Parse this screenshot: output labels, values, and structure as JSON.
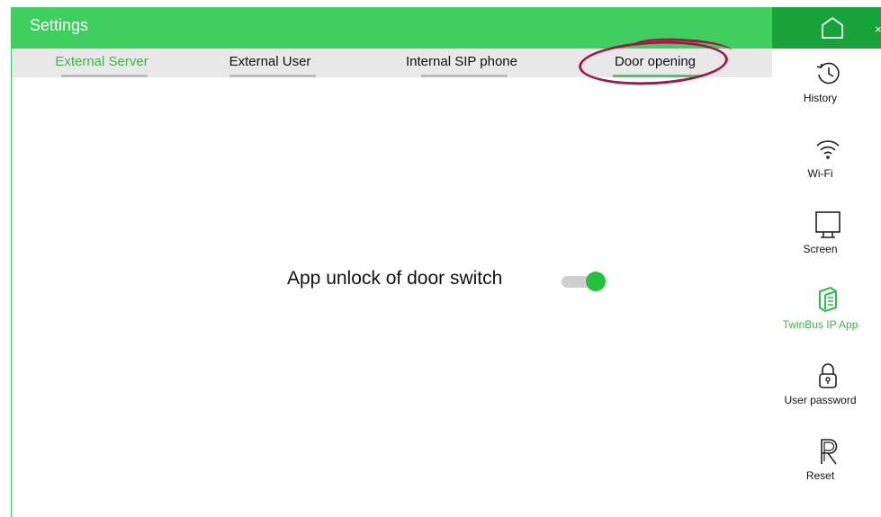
{
  "header": {
    "title": "Settings"
  },
  "tabs": [
    {
      "label": "External Server"
    },
    {
      "label": "External User"
    },
    {
      "label": "Internal SIP phone"
    },
    {
      "label": "Door opening"
    }
  ],
  "setting": {
    "label": "App unlock of door switch",
    "enabled": true
  },
  "sidebar": {
    "close": "×",
    "items": [
      {
        "label": "History",
        "icon": "history-icon"
      },
      {
        "label": "Wi-Fi",
        "icon": "wifi-icon"
      },
      {
        "label": "Screen",
        "icon": "screen-icon"
      },
      {
        "label": "TwinBus IP App",
        "icon": "app-icon"
      },
      {
        "label": "User password",
        "icon": "lock-icon"
      },
      {
        "label": "Reset",
        "icon": "reset-icon"
      }
    ]
  },
  "colors": {
    "accent": "#3ecf5f",
    "accent_dark": "#18a33a",
    "active_text": "#3ab54a",
    "annotation": "#a3174a"
  }
}
